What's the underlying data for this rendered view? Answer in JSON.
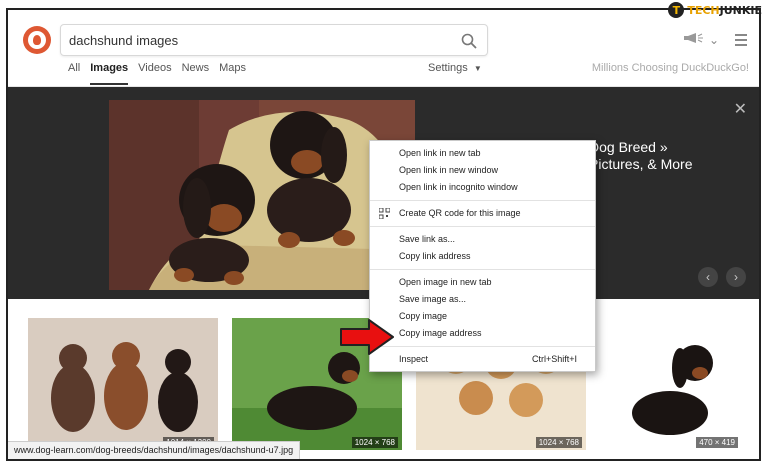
{
  "watermark": {
    "mark": "T",
    "part1": "TECH",
    "part2": "JUNKIE"
  },
  "search": {
    "query": "dachshund images"
  },
  "tabs": [
    {
      "label": "All"
    },
    {
      "label": "Images"
    },
    {
      "label": "Videos"
    },
    {
      "label": "News"
    },
    {
      "label": "Maps"
    }
  ],
  "settings": {
    "label": "Settings"
  },
  "tagline": "Millions Choosing DuckDuckGo!",
  "detail": {
    "title_line1": "Dog Breed »",
    "title_line2": "Pictures, & More"
  },
  "context_menu": {
    "group1": [
      "Open link in new tab",
      "Open link in new window",
      "Open link in incognito window"
    ],
    "qr": "Create QR code for this image",
    "group2": [
      "Save link as...",
      "Copy link address"
    ],
    "group3": [
      "Open image in new tab",
      "Save image as...",
      "Copy image",
      "Copy image address"
    ],
    "inspect": {
      "label": "Inspect",
      "shortcut": "Ctrl+Shift+I"
    }
  },
  "thumbnails": [
    {
      "dims": "1014 × 1200"
    },
    {
      "dims": "1024 × 768"
    },
    {
      "dims": "1024 × 768"
    },
    {
      "dims": "470 × 419"
    }
  ],
  "status_url": "www.dog-learn.com/dog-breeds/dachshund/images/dachshund-u7.jpg",
  "colors": {
    "brand": "#de5833",
    "accent_arrow": "#e81010",
    "detail_bg": "#2b2b2b"
  }
}
